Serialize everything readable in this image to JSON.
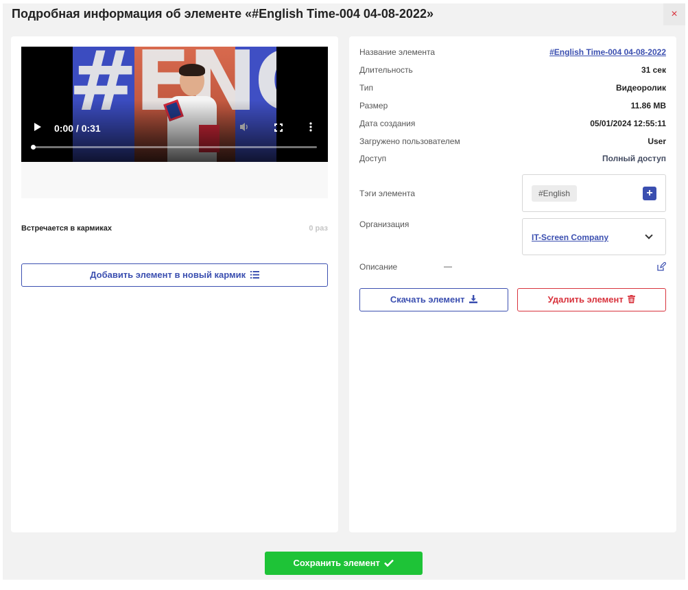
{
  "dialog": {
    "title": "Подробная информация об элементе «#English Time-004 04-08-2022»",
    "close_label": "×",
    "save_label": "Сохранить элемент"
  },
  "video": {
    "time": "0:00 / 0:31",
    "thumbnail_text": "#ENG",
    "progress_percent": 0
  },
  "usage": {
    "label": "Встречается в кармиках",
    "count": "0 раз"
  },
  "add_to_pocket_label": "Добавить элемент в новый кармик",
  "details": {
    "name_label": "Название элемента",
    "name_value": "#English Time-004 04-08-2022",
    "duration_label": "Длительность",
    "duration_value": "31 сек",
    "type_label": "Тип",
    "type_value": "Видеоролик",
    "size_label": "Размер",
    "size_value": "11.86 MB",
    "created_label": "Дата создания",
    "created_value": "05/01/2024 12:55:11",
    "uploaded_label": "Загружено пользователем",
    "uploaded_value": "User",
    "access_label": "Доступ",
    "access_value": "Полный доступ"
  },
  "tags": {
    "label": "Тэги элемента",
    "items": [
      "#English"
    ],
    "add_label": "+"
  },
  "organization": {
    "label": "Организация",
    "value": "IT-Screen Company"
  },
  "description": {
    "label": "Описание",
    "value": "—"
  },
  "actions": {
    "download_label": "Скачать элемент",
    "delete_label": "Удалить элемент"
  },
  "colors": {
    "accent": "#3b4fb0",
    "danger": "#d8323c",
    "success": "#1ec337",
    "background": "#f2f2f2"
  },
  "icons": [
    "list-icon",
    "download-icon",
    "trash-icon",
    "check-icon",
    "edit-icon",
    "chevron-down-icon",
    "play-icon",
    "volume-icon",
    "fullscreen-icon",
    "more-vertical-icon"
  ]
}
